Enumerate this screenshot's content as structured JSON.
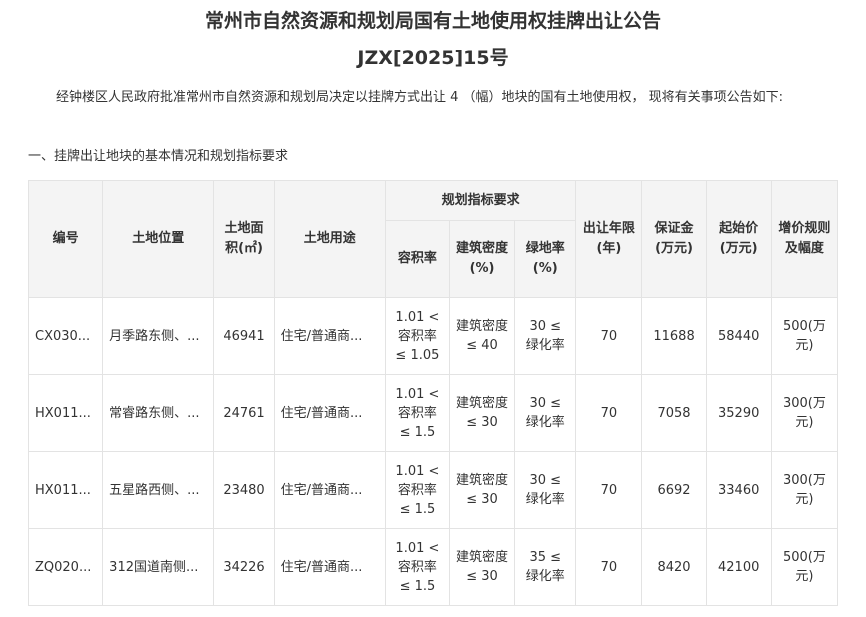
{
  "header": {
    "title": "常州市自然资源和规划局国有土地使用权挂牌出让公告",
    "doc_number": "JZX[2025]15号"
  },
  "intro": "经钟楼区人民政府批准常州市自然资源和规划局决定以挂牌方式出让 4 （幅）地块的国有土地使用权， 现将有关事项公告如下:",
  "section_heading": "一、挂牌出让地块的基本情况和规划指标要求",
  "table": {
    "headers": {
      "code": "编号",
      "location": "土地位置",
      "area": "土地面积(㎡)",
      "use": "土地用途",
      "planning_group": "规划指标要求",
      "far": "容积率",
      "density": "建筑密度(%)",
      "green": "绿地率(%)",
      "term": "出让年限(年)",
      "deposit": "保证金(万元)",
      "start_price": "起始价(万元)",
      "increment": "增价规则及幅度"
    },
    "rows": [
      {
        "code": "CX030...",
        "location": "月季路东侧、...",
        "area": "46941",
        "use": "住宅/普通商...",
        "far": "1.01 < 容积率 ≤ 1.05",
        "density": "建筑密度 ≤ 40",
        "green": "30 ≤ 绿化率",
        "term": "70",
        "deposit": "11688",
        "start_price": "58440",
        "increment": "500(万元)"
      },
      {
        "code": "HX011...",
        "location": "常睿路东侧、...",
        "area": "24761",
        "use": "住宅/普通商...",
        "far": "1.01 < 容积率 ≤ 1.5",
        "density": "建筑密度 ≤ 30",
        "green": "30 ≤ 绿化率",
        "term": "70",
        "deposit": "7058",
        "start_price": "35290",
        "increment": "300(万元)"
      },
      {
        "code": "HX011...",
        "location": "五星路西侧、...",
        "area": "23480",
        "use": "住宅/普通商...",
        "far": "1.01 < 容积率 ≤ 1.5",
        "density": "建筑密度 ≤ 30",
        "green": "30 ≤ 绿化率",
        "term": "70",
        "deposit": "6692",
        "start_price": "33460",
        "increment": "300(万元)"
      },
      {
        "code": "ZQ020...",
        "location": "312国道南侧...",
        "area": "34226",
        "use": "住宅/普通商...",
        "far": "1.01 < 容积率 ≤ 1.5",
        "density": "建筑密度 ≤ 30",
        "green": "35 ≤ 绿化率",
        "term": "70",
        "deposit": "8420",
        "start_price": "42100",
        "increment": "500(万元)"
      }
    ]
  },
  "colors": {
    "link": "#d9532c",
    "header_bg": "#f4f4f4",
    "border": "#e3e3e3",
    "text": "#333333"
  }
}
